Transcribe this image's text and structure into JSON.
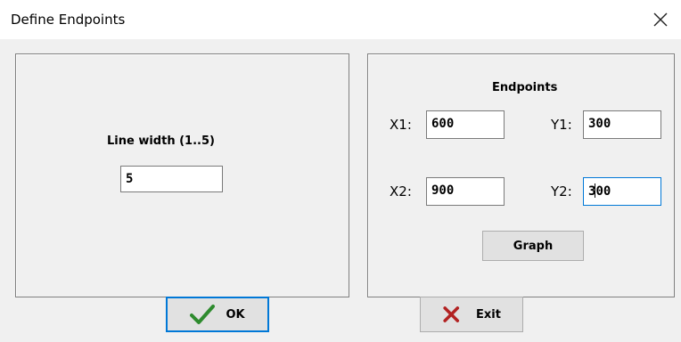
{
  "window": {
    "title": "Define Endpoints"
  },
  "line_panel": {
    "label": "Line width (1..5)",
    "value": "5"
  },
  "endpoints_panel": {
    "heading": "Endpoints",
    "x1": {
      "label": "X1:",
      "value": "600"
    },
    "y1": {
      "label": "Y1:",
      "value": "300"
    },
    "x2": {
      "label": "X2:",
      "value": "900"
    },
    "y2": {
      "label": "Y2:",
      "value_before_caret": "3",
      "value_after_caret": "00"
    },
    "graph_button": "Graph"
  },
  "buttons": {
    "ok": "OK",
    "exit": "Exit"
  },
  "icons": {
    "ok": "checkmark-icon",
    "exit": "x-icon",
    "close": "close-icon"
  },
  "colors": {
    "ok_check": "#2e8b2e",
    "exit_x": "#b22222",
    "focus": "#0078d7"
  }
}
